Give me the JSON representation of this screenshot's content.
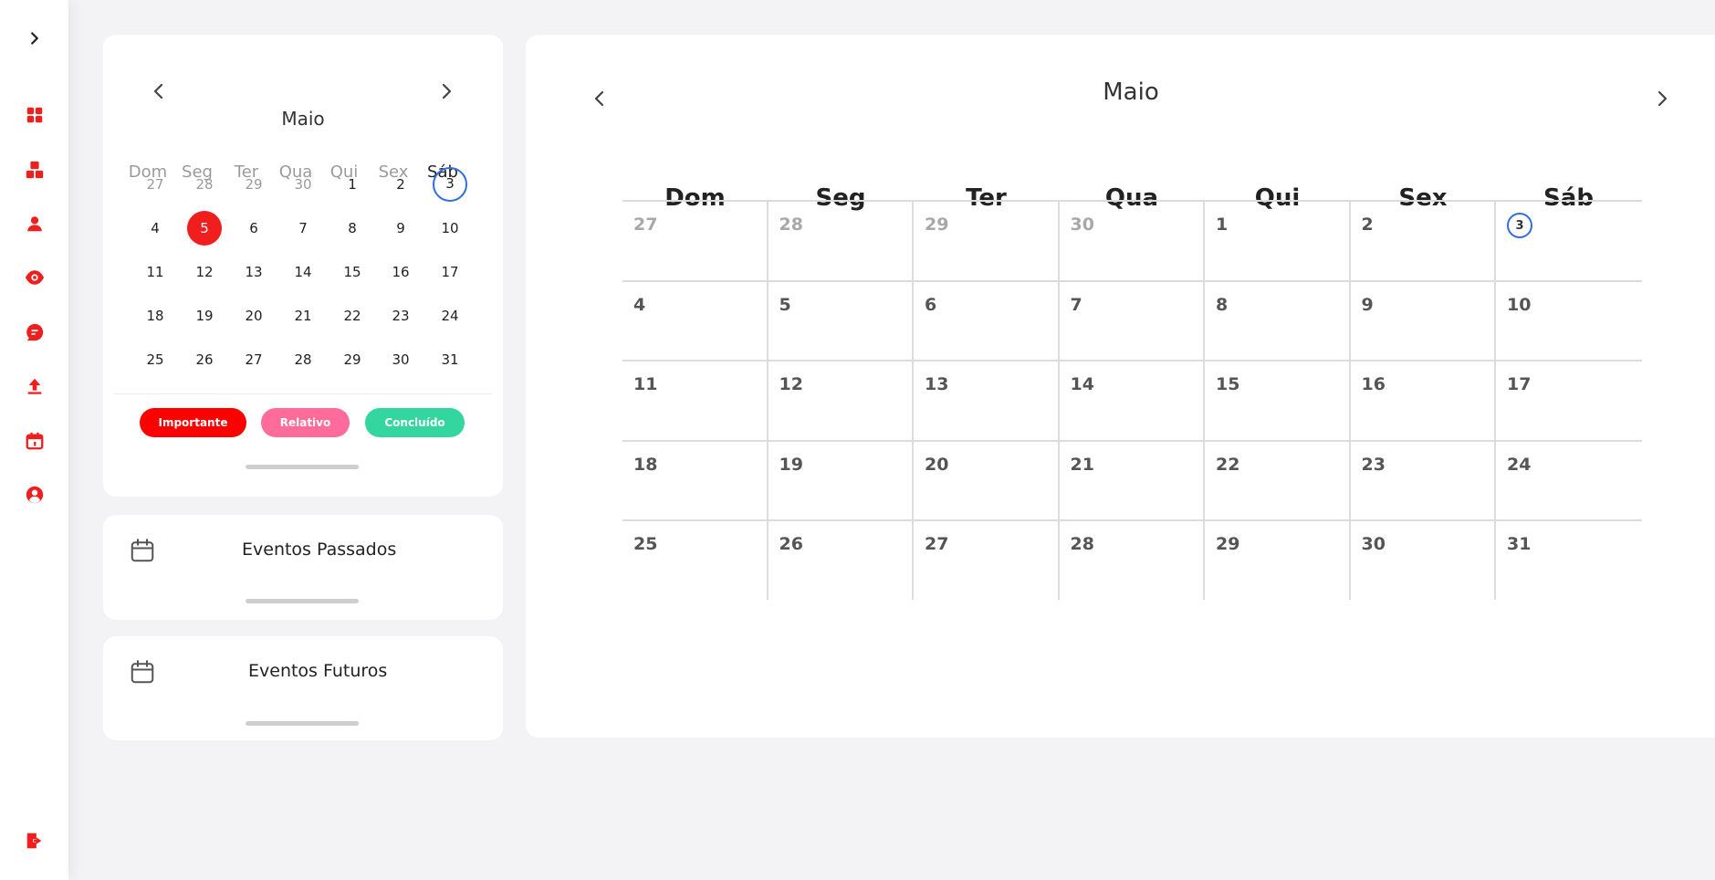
{
  "sidebar": {
    "toggle_icon": "chevron-right-icon",
    "items": [
      {
        "name": "dashboard-icon"
      },
      {
        "name": "blocks-icon"
      },
      {
        "name": "user-icon"
      },
      {
        "name": "eye-icon"
      },
      {
        "name": "chat-icon"
      },
      {
        "name": "upload-icon"
      },
      {
        "name": "calendar-icon"
      },
      {
        "name": "account-icon"
      }
    ],
    "logout_icon": "logout-icon",
    "accent_color": "#f11e1e"
  },
  "mini_calendar": {
    "month": "Maio",
    "weekdays": [
      "Dom",
      "Seg",
      "Ter",
      "Qua",
      "Qui",
      "Sex",
      "Sáb"
    ],
    "weeks": [
      [
        "27",
        "28",
        "29",
        "30",
        "1",
        "2",
        "3"
      ],
      [
        "4",
        "5",
        "6",
        "7",
        "8",
        "9",
        "10"
      ],
      [
        "11",
        "12",
        "13",
        "14",
        "15",
        "16",
        "17"
      ],
      [
        "18",
        "19",
        "20",
        "21",
        "22",
        "23",
        "24"
      ],
      [
        "25",
        "26",
        "27",
        "28",
        "29",
        "30",
        "31"
      ]
    ],
    "selected_day": "5",
    "today": "3",
    "today_ring_color": "#2f6fe0"
  },
  "legend": [
    {
      "label": "Importante",
      "color": "#ff0000"
    },
    {
      "label": "Relativo",
      "color": "#ff6b9a"
    },
    {
      "label": "Concluído",
      "color": "#33d69f"
    }
  ],
  "panels": {
    "past_events": "Eventos Passados",
    "future_events": "Eventos Futuros"
  },
  "main_calendar": {
    "month": "Maio",
    "weekdays": [
      "Dom",
      "Seg",
      "Ter",
      "Qua",
      "Qui",
      "Sex",
      "Sáb"
    ],
    "weeks": [
      [
        "27",
        "28",
        "29",
        "30",
        "1",
        "2",
        "3"
      ],
      [
        "4",
        "5",
        "6",
        "7",
        "8",
        "9",
        "10"
      ],
      [
        "11",
        "12",
        "13",
        "14",
        "15",
        "16",
        "17"
      ],
      [
        "18",
        "19",
        "20",
        "21",
        "22",
        "23",
        "24"
      ],
      [
        "25",
        "26",
        "27",
        "28",
        "29",
        "30",
        "31"
      ]
    ],
    "today": "3"
  }
}
